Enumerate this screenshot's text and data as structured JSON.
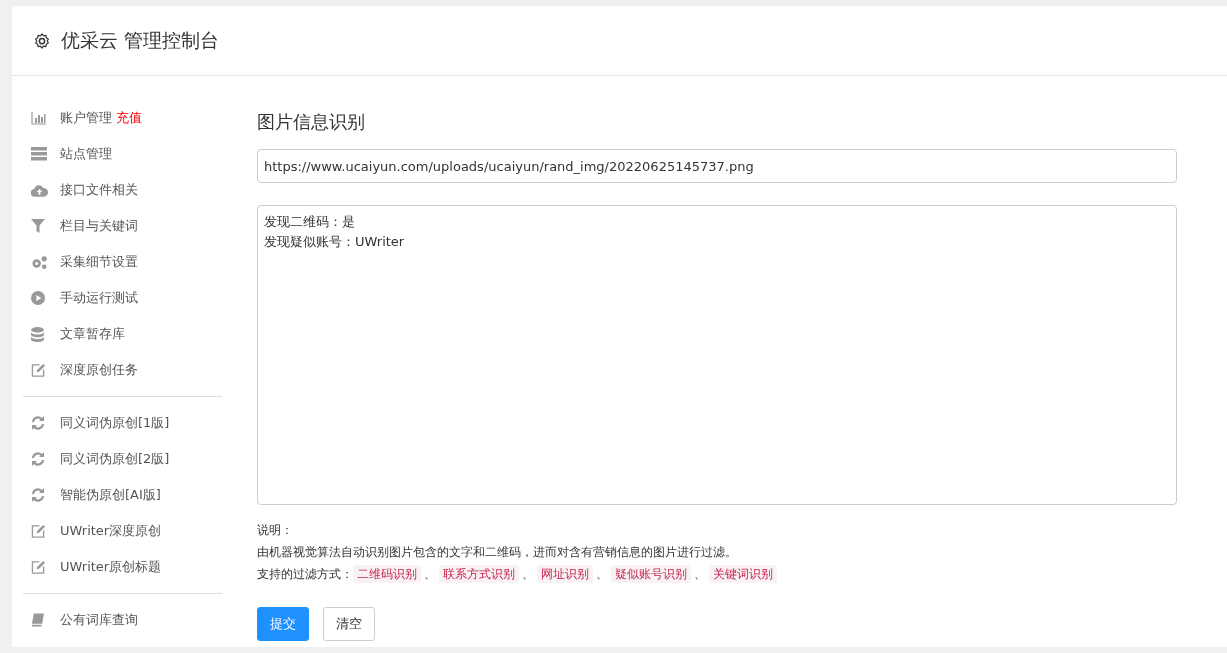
{
  "header": {
    "title": "优采云 管理控制台"
  },
  "sidebar": {
    "groups": [
      {
        "items": [
          {
            "label": "账户管理",
            "kind": "chart",
            "badge": "充值"
          },
          {
            "label": "站点管理",
            "kind": "server"
          },
          {
            "label": "接口文件相关",
            "kind": "cloud"
          },
          {
            "label": "栏目与关键词",
            "kind": "filter"
          },
          {
            "label": "采集细节设置",
            "kind": "gears"
          },
          {
            "label": "手动运行测试",
            "kind": "play"
          },
          {
            "label": "文章暂存库",
            "kind": "database"
          },
          {
            "label": "深度原创任务",
            "kind": "edit"
          }
        ]
      },
      {
        "items": [
          {
            "label": "同义词伪原创[1版]",
            "kind": "refresh"
          },
          {
            "label": "同义词伪原创[2版]",
            "kind": "refresh"
          },
          {
            "label": "智能伪原创[AI版]",
            "kind": "refresh"
          },
          {
            "label": "UWriter深度原创",
            "kind": "edit"
          },
          {
            "label": "UWriter原创标题",
            "kind": "edit"
          }
        ]
      },
      {
        "items": [
          {
            "label": "公有词库查询",
            "kind": "book"
          }
        ]
      }
    ]
  },
  "main": {
    "title": "图片信息识别",
    "url_field": {
      "value": "https://www.ucaiyun.com/uploads/ucaiyun/rand_img/20220625145737.png"
    },
    "result_field": {
      "lines": [
        "发现二维码：是",
        "发现疑似账号：UWriter"
      ]
    },
    "notes": {
      "heading": "说明：",
      "description": "由机器视觉算法自动识别图片包含的文字和二维码，进而对含有营销信息的图片进行过滤。",
      "methods_label": "支持的过滤方式：",
      "methods": [
        "二维码识别",
        "联系方式识别",
        "网址识别",
        "疑似账号识别",
        "关键词识别"
      ],
      "separator": "、"
    },
    "buttons": [
      {
        "label": "提交",
        "kind": "primary"
      },
      {
        "label": "清空",
        "kind": "default"
      }
    ]
  }
}
